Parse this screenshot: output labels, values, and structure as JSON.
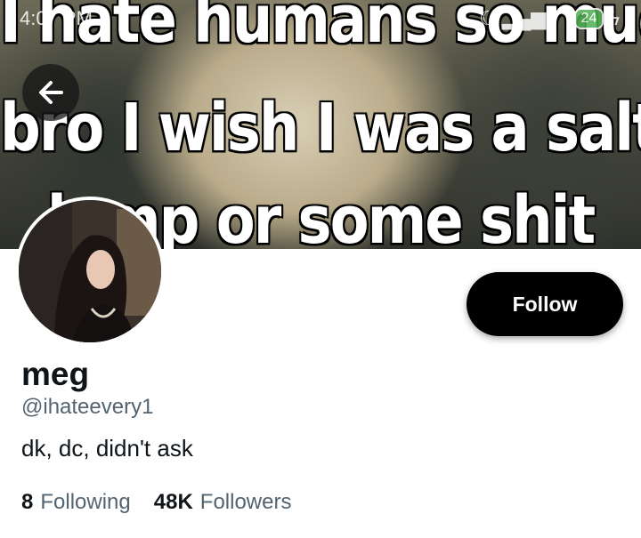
{
  "status_bar": {
    "time": "4:07 PM",
    "battery": "24"
  },
  "banner": {
    "lines": [
      "I hate humans so much",
      "bro I wish I was a salt",
      "lamp or some shit"
    ]
  },
  "profile": {
    "display_name": "meg",
    "handle": "@ihateevery1",
    "bio": "dk, dc, didn't ask",
    "follow_label": "Follow",
    "following_count": "8",
    "following_label": "Following",
    "followers_count": "48K",
    "followers_label": "Followers"
  },
  "colors": {
    "primary_text": "#0f1419",
    "secondary_text": "#536471",
    "follow_bg": "#000000"
  },
  "icons": {
    "back": "arrow-left-icon",
    "signal": "signal-icon",
    "wifi": "wifi-icon",
    "battery": "battery-icon",
    "moon": "moon-icon"
  }
}
